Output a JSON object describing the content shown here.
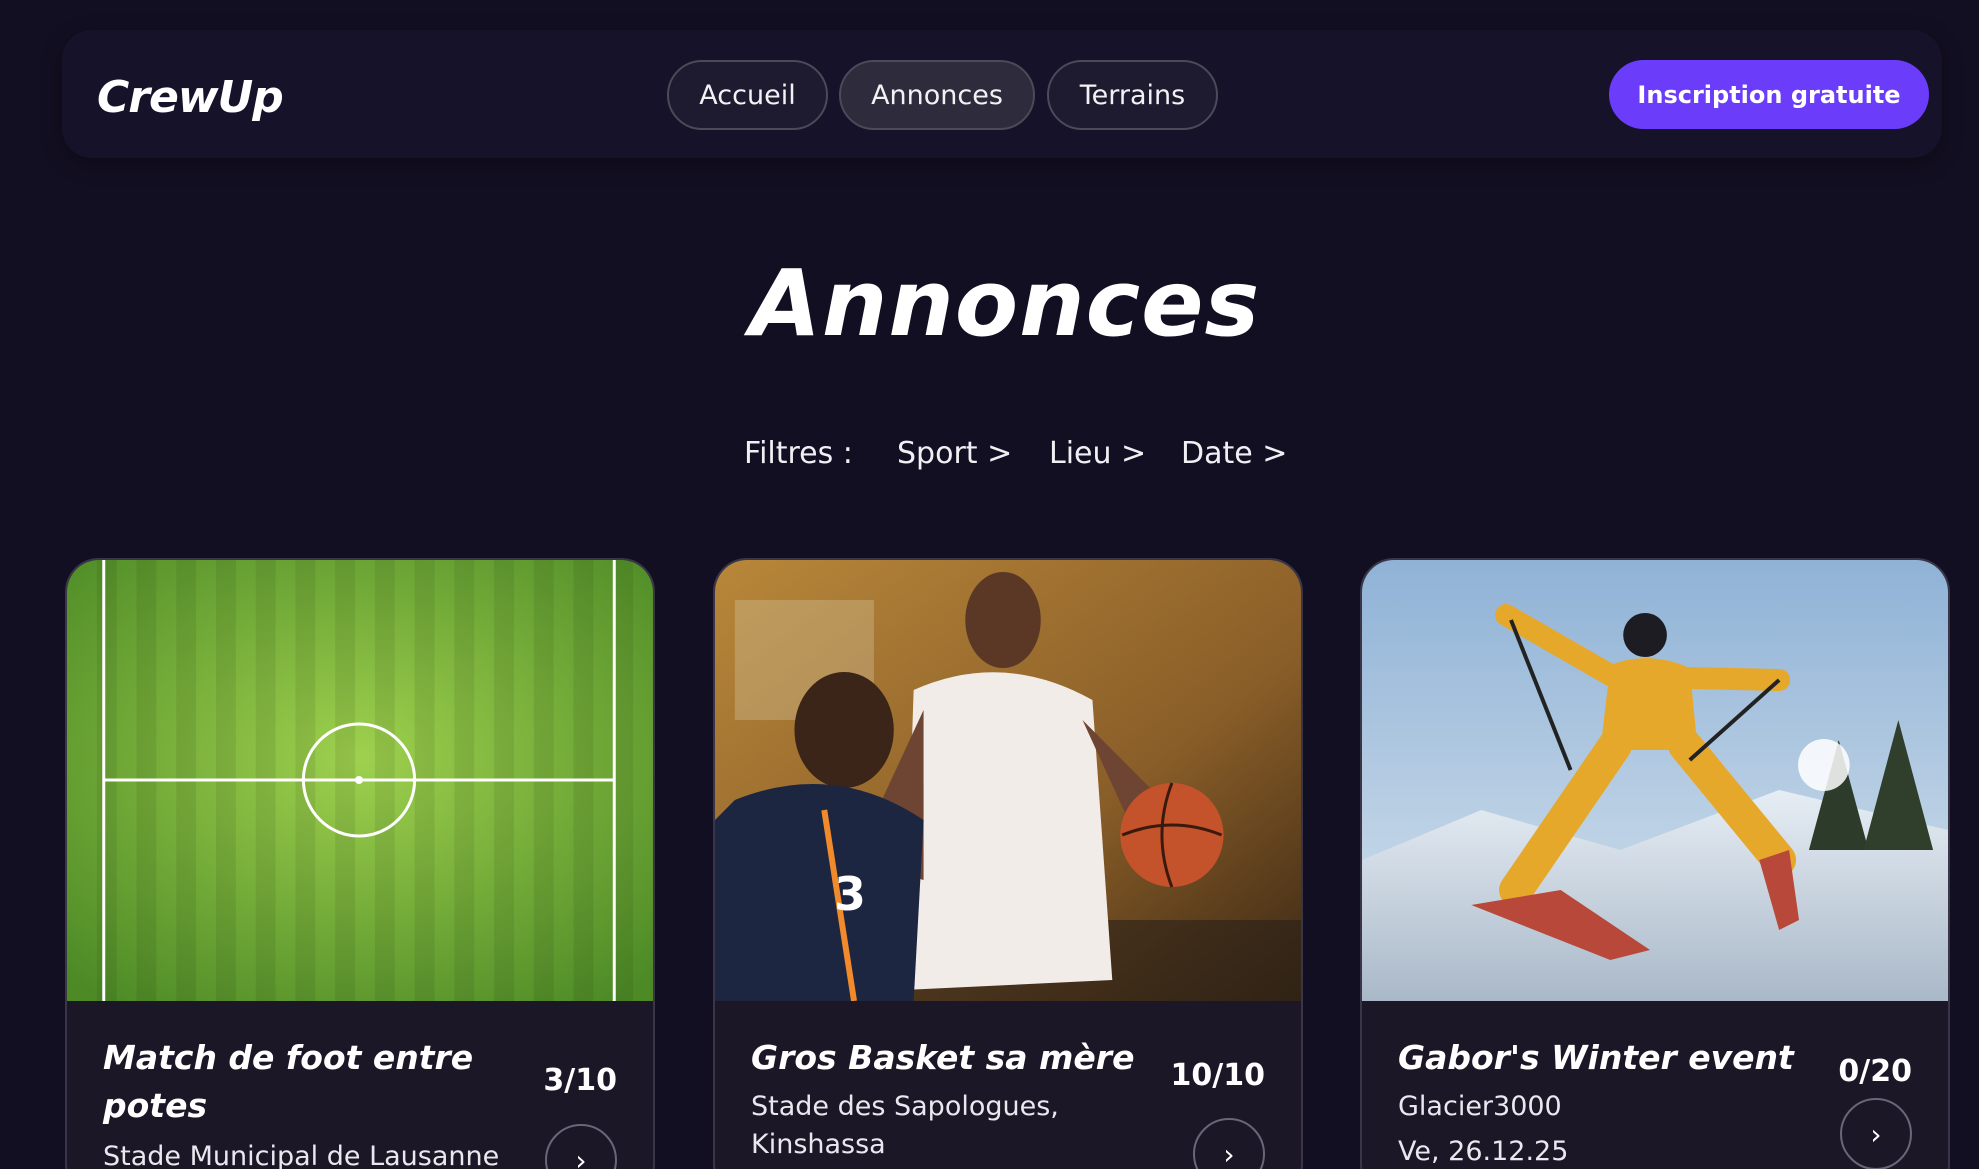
{
  "header": {
    "logo": "CrewUp",
    "nav": [
      {
        "label": "Accueil",
        "active": false
      },
      {
        "label": "Annonces",
        "active": true
      },
      {
        "label": "Terrains",
        "active": false
      }
    ],
    "cta_label": "Inscription gratuite"
  },
  "page": {
    "title": "Annonces"
  },
  "filters": {
    "label": "Filtres :",
    "items": [
      "Sport >",
      "Lieu >",
      "Date >"
    ]
  },
  "cards": [
    {
      "title": "Match de foot entre potes",
      "count": "3/10",
      "location": "Stade Municipal de Lausanne",
      "date": "",
      "image": "soccer-field",
      "arrow": "›"
    },
    {
      "title": "Gros Basket sa mère",
      "count": "10/10",
      "location": "Stade des Sapologues, Kinshassa",
      "date": "",
      "image": "basketball-players",
      "arrow": "›"
    },
    {
      "title": "Gabor's Winter event",
      "count": "0/20",
      "location": "Glacier3000",
      "date": "Ve, 26.12.25",
      "image": "skier-in-snow",
      "arrow": "›"
    }
  ],
  "colors": {
    "background": "#130f22",
    "accent": "#6b3dfa",
    "card": "#1b1726"
  }
}
